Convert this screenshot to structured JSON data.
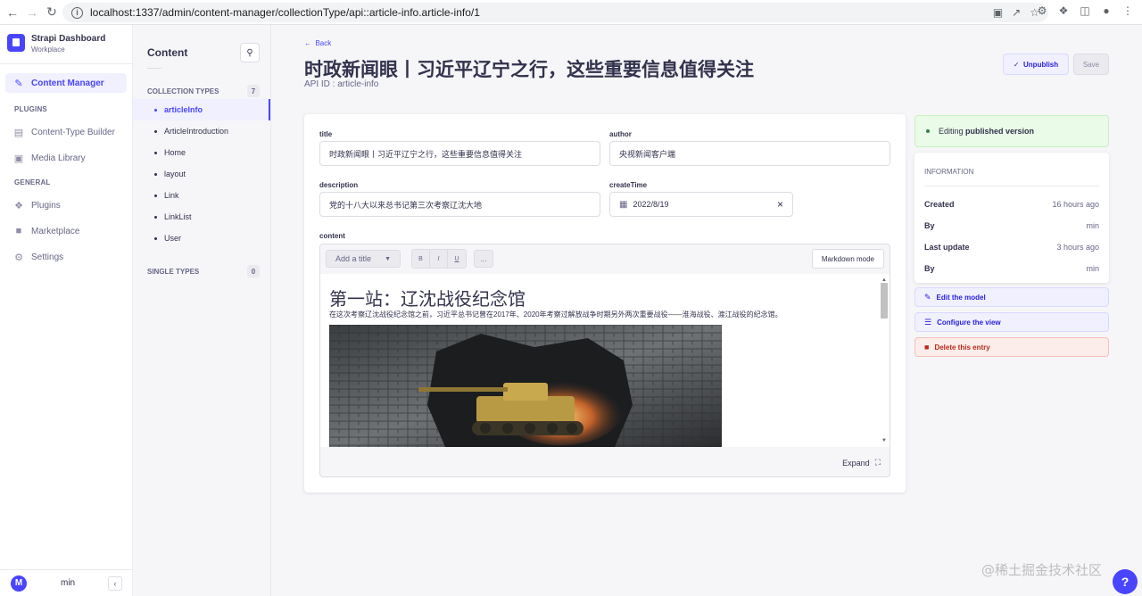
{
  "browser": {
    "url": "localhost:1337/admin/content-manager/collectionType/api::article-info.article-info/1"
  },
  "brand": {
    "title": "Strapi Dashboard",
    "subtitle": "Workplace"
  },
  "mainnav": {
    "content_manager": "Content Manager",
    "plugins_section": "PLUGINS",
    "content_type_builder": "Content-Type Builder",
    "media_library": "Media Library",
    "general_section": "GENERAL",
    "plugins": "Plugins",
    "marketplace": "Marketplace",
    "settings": "Settings"
  },
  "user": {
    "initial": "M",
    "name": "min"
  },
  "subnav": {
    "title": "Content",
    "collection_types_label": "COLLECTION TYPES",
    "collection_count": "7",
    "collection_types": [
      "articleInfo",
      "ArticleIntroduction",
      "Home",
      "layout",
      "Link",
      "LinkList",
      "User"
    ],
    "single_types_label": "SINGLE TYPES",
    "single_count": "0"
  },
  "header": {
    "back": "Back",
    "title": "时政新闻眼丨习近平辽宁之行，这些重要信息值得关注",
    "api_id": "API ID : article-info",
    "unpublish": "Unpublish",
    "save": "Save"
  },
  "form": {
    "title_label": "title",
    "title_value": "时政新闻眼丨习近平辽宁之行，这些重要信息值得关注",
    "author_label": "author",
    "author_value": "央视新闻客户端",
    "description_label": "description",
    "description_value": "党的十八大以来总书记第三次考察辽沈大地",
    "createtime_label": "createTime",
    "createtime_value": "2022/8/19",
    "content_label": "content"
  },
  "editor": {
    "add_title": "Add a title",
    "bold": "B",
    "italic": "I",
    "underline": "U",
    "more": "...",
    "markdown_mode": "Markdown mode",
    "preview_heading": "第一站：辽沈战役纪念馆",
    "preview_paragraph": "在这次考察辽沈战役纪念馆之前，习近平总书记曾在2017年、2020年考察过解放战争时期另外两次重要战役——淮海战役、渡江战役的纪念馆。",
    "expand": "Expand"
  },
  "panel": {
    "status_prefix": "Editing ",
    "status_strong": "published version",
    "info_title": "INFORMATION",
    "created_label": "Created",
    "created_value": "16 hours ago",
    "by_label": "By",
    "created_by": "min",
    "updated_label": "Last update",
    "updated_value": "3 hours ago",
    "updated_by": "min",
    "edit_model": "Edit the model",
    "configure_view": "Configure the view",
    "delete_entry": "Delete this entry"
  },
  "watermark": "@稀土掘金技术社区",
  "help": "?",
  "colors": {
    "primary": "#4945ff",
    "success_bg": "#eafbe7",
    "danger": "#b72b1a"
  }
}
